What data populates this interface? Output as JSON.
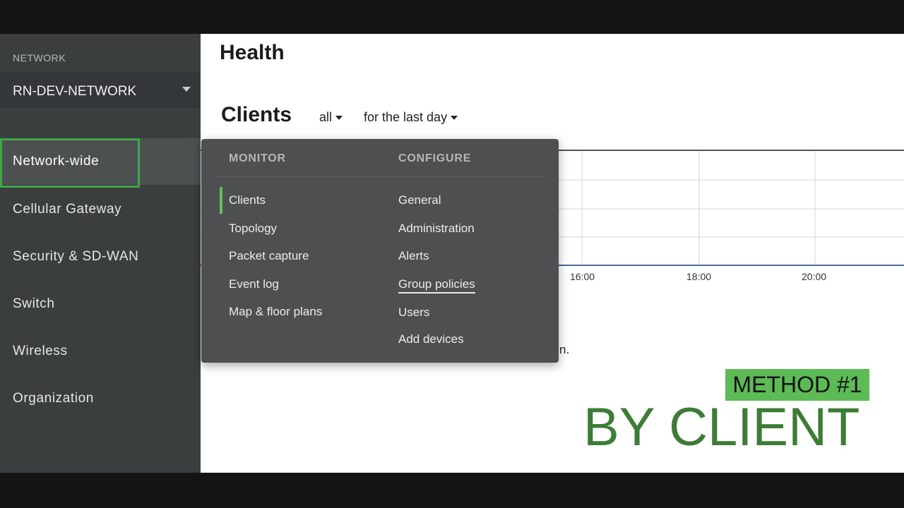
{
  "sidebar": {
    "network_label": "NETWORK",
    "network_value": "RN-DEV-NETWORK",
    "items": [
      {
        "label": "Network-wide"
      },
      {
        "label": "Cellular Gateway"
      },
      {
        "label": "Security & SD-WAN"
      },
      {
        "label": "Switch"
      },
      {
        "label": "Wireless"
      },
      {
        "label": "Organization"
      }
    ]
  },
  "main": {
    "page_title": "Health",
    "section_title": "Clients",
    "filter_all": "all",
    "filter_time": "for the last day",
    "chart_ticks": [
      "16:00",
      "18:00",
      "20:00"
    ],
    "partial_text": "n."
  },
  "menu": {
    "monitor_heading": "MONITOR",
    "configure_heading": "CONFIGURE",
    "monitor_items": [
      "Clients",
      "Topology",
      "Packet capture",
      "Event log",
      "Map & floor plans"
    ],
    "configure_items": [
      "General",
      "Administration",
      "Alerts",
      "Group policies",
      "Users",
      "Add devices"
    ]
  },
  "overlay": {
    "badge": "METHOD #1",
    "title": "BY CLIENT"
  },
  "colors": {
    "accent_green": "#3fa648",
    "badge_green": "#5dbb55",
    "title_green": "#3d7c36",
    "sidebar_bg": "#3a3e3f",
    "menu_bg": "#4d4f50"
  }
}
